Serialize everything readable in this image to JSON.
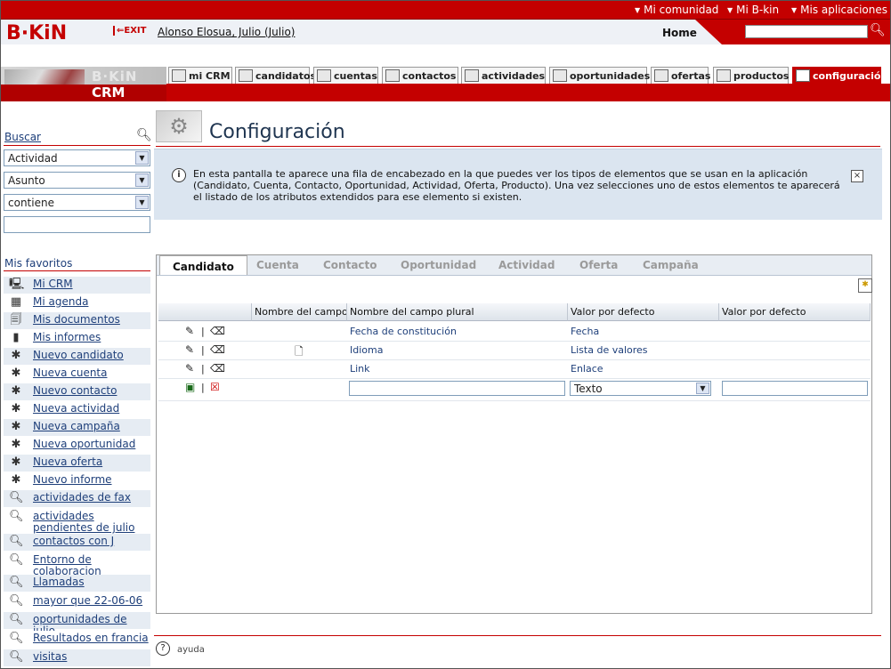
{
  "topbar": {
    "links": [
      "Mi comunidad",
      "Mi B-kin",
      "Mis aplicaciones"
    ]
  },
  "header": {
    "logo": "B·KiN",
    "exit_label": "EXIT",
    "user": "Alonso Elosua, Julio (Julio)",
    "home_label": "Home",
    "search_value": ""
  },
  "brand": {
    "product": "B·KiN",
    "module": "CRM"
  },
  "tabs": [
    {
      "label": "mi CRM",
      "icon": "monitor-icon"
    },
    {
      "label": "candidatos",
      "icon": "person-icon"
    },
    {
      "label": "cuentas",
      "icon": "folder-icon"
    },
    {
      "label": "contactos",
      "icon": "contact-card-icon"
    },
    {
      "label": "actividades",
      "icon": "activity-icon"
    },
    {
      "label": "oportunidades",
      "icon": "coins-icon"
    },
    {
      "label": "ofertas",
      "icon": "exclamation-icon"
    },
    {
      "label": "productos",
      "icon": "box-icon"
    },
    {
      "label": "configuración",
      "icon": "wrench-icon",
      "active": true
    }
  ],
  "sidebar": {
    "search_label": "Buscar",
    "selects": [
      "Actividad",
      "Asunto",
      "contiene"
    ],
    "search_text": "",
    "favorites_title": "Mis favoritos",
    "favorites": [
      {
        "label": "Mi CRM",
        "icon": "monitor-icon"
      },
      {
        "label": "Mi agenda",
        "icon": "calendar-icon"
      },
      {
        "label": "Mis documentos",
        "icon": "documents-icon"
      },
      {
        "label": "Mis informes",
        "icon": "bar-chart-icon"
      },
      {
        "label": "Nuevo candidato",
        "icon": "new-candidate-icon"
      },
      {
        "label": "Nueva cuenta",
        "icon": "new-account-icon"
      },
      {
        "label": "Nuevo contacto",
        "icon": "new-contact-icon"
      },
      {
        "label": "Nueva actividad",
        "icon": "new-activity-icon"
      },
      {
        "label": "Nueva campaña",
        "icon": "new-campaign-icon"
      },
      {
        "label": "Nueva oportunidad",
        "icon": "new-opportunity-icon"
      },
      {
        "label": "Nueva oferta",
        "icon": "new-offer-icon"
      },
      {
        "label": "Nuevo informe",
        "icon": "new-report-icon"
      },
      {
        "label": "actividades de fax",
        "icon": "search-icon"
      },
      {
        "label": "actividades pendientes de julio",
        "icon": "search-icon"
      },
      {
        "label": "contactos con J",
        "icon": "search-icon"
      },
      {
        "label": "Entorno de colaboracion",
        "icon": "search-icon"
      },
      {
        "label": "Llamadas",
        "icon": "search-icon"
      },
      {
        "label": "mayor que 22-06-06",
        "icon": "search-icon"
      },
      {
        "label": "oportunidades de julio",
        "icon": "search-icon"
      },
      {
        "label": "Resultados en francia",
        "icon": "search-icon"
      },
      {
        "label": "visitas",
        "icon": "search-icon"
      }
    ]
  },
  "main": {
    "title": "Configuración",
    "info": "En esta pantalla te aparece una fila de encabezado en la que puedes ver los tipos de elementos que se usan en la aplicación (Candidato, Cuenta, Contacto, Oportunidad, Actividad, Oferta, Producto). Una vez selecciones uno de estos elementos te aparecerá el listado de los atributos extendidos para ese elemento si existen.",
    "subtabs": [
      "Candidato",
      "Cuenta",
      "Contacto",
      "Oportunidad",
      "Actividad",
      "Oferta",
      "Campaña"
    ],
    "columns": [
      "Nombre del campo",
      "Nombre del campo plural",
      "Valor por defecto",
      "Valor por defecto"
    ],
    "rows": [
      {
        "plural": "Fecha de constitución",
        "type": "Fecha"
      },
      {
        "plural": "Idioma",
        "type": "Lista de valores"
      },
      {
        "plural": "Link",
        "type": "Enlace"
      }
    ],
    "new_row": {
      "plural": "",
      "type": "Texto",
      "default": ""
    },
    "help_label": "ayuda"
  }
}
